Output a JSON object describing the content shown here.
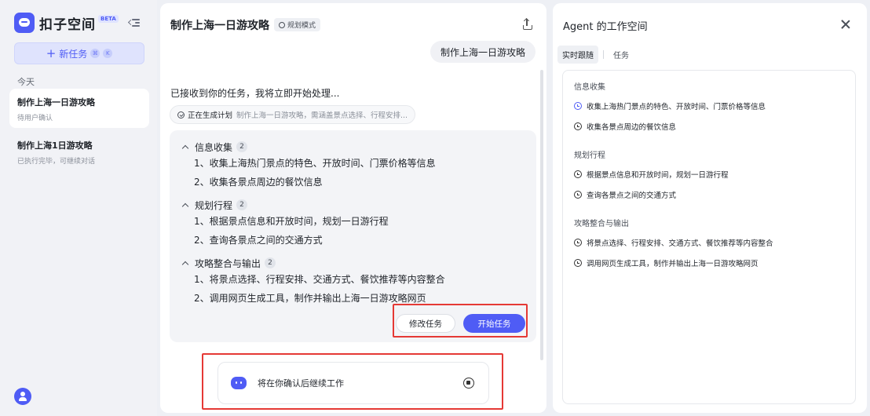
{
  "sidebar": {
    "app_name": "扣子空间",
    "beta_badge": "BETA",
    "new_task_label": "新任务",
    "kbd_keys": [
      "⌘",
      "K"
    ],
    "today_label": "今天",
    "history": [
      {
        "title": "制作上海一日游攻略",
        "status": "待用户确认"
      },
      {
        "title": "制作上海1日游攻略",
        "status": "已执行完毕，可继续对话"
      }
    ]
  },
  "chat": {
    "title": "制作上海一日游攻略",
    "mode_badge": "规划模式",
    "user_message": "制作上海一日游攻略",
    "ack_text": "已接收到你的任务，我将立即开始处理...",
    "generating_label": "正在生成计划",
    "generating_desc": "制作上海一日游攻略，需涵盖景点选择、行程安排...",
    "plan": [
      {
        "title": "信息收集",
        "count": "2",
        "steps": [
          "1、收集上海热门景点的特色、开放时间、门票价格等信息",
          "2、收集各景点周边的餐饮信息"
        ]
      },
      {
        "title": "规划行程",
        "count": "2",
        "steps": [
          "1、根据景点信息和开放时间，规划一日游行程",
          "2、查询各景点之间的交通方式"
        ]
      },
      {
        "title": "攻略整合与输出",
        "count": "2",
        "steps": [
          "1、将景点选择、行程安排、交通方式、餐饮推荐等内容整合",
          "2、调用网页生成工具，制作并输出上海一日游攻略网页"
        ]
      }
    ],
    "edit_button": "修改任务",
    "start_button": "开始任务",
    "status_text": "将在你确认后继续工作"
  },
  "workspace": {
    "title": "Agent 的工作空间",
    "tabs": [
      "实时跟随",
      "任务"
    ],
    "groups": [
      {
        "title": "信息收集",
        "items": [
          "收集上海热门景点的特色、开放时间、门票价格等信息",
          "收集各景点周边的餐饮信息"
        ]
      },
      {
        "title": "规划行程",
        "items": [
          "根据景点信息和开放时间，规划一日游行程",
          "查询各景点之间的交通方式"
        ]
      },
      {
        "title": "攻略整合与输出",
        "items": [
          "将景点选择、行程安排、交通方式、餐饮推荐等内容整合",
          "调用网页生成工具，制作并输出上海一日游攻略网页"
        ]
      }
    ]
  },
  "colors": {
    "accent": "#4f5cf5",
    "highlight": "#e53935"
  }
}
